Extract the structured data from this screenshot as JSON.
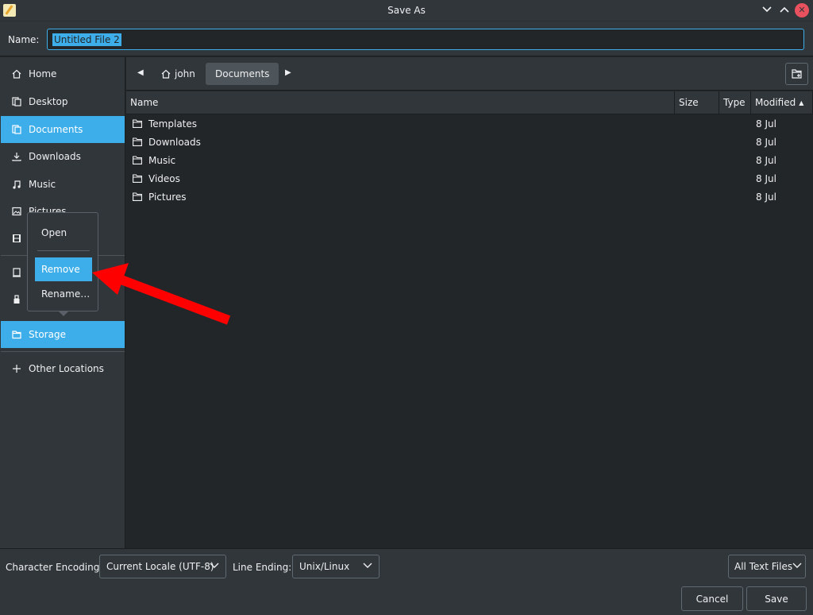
{
  "window": {
    "title": "Save As"
  },
  "name_row": {
    "label": "Name:",
    "value": "Untitled File 2"
  },
  "sidebar": {
    "items": [
      {
        "label": "Home",
        "icon": "home-icon"
      },
      {
        "label": "Desktop",
        "icon": "desktop-icon"
      },
      {
        "label": "Documents",
        "icon": "documents-icon",
        "active": true
      },
      {
        "label": "Downloads",
        "icon": "download-icon"
      },
      {
        "label": "Music",
        "icon": "music-icon"
      },
      {
        "label": "Pictures",
        "icon": "pictures-icon"
      },
      {
        "label": "",
        "icon": "videos-icon"
      },
      {
        "label": "",
        "icon": "device-icon"
      },
      {
        "label": "",
        "icon": "usb-icon"
      },
      {
        "label": "Storage",
        "icon": "folder-icon",
        "active": true
      },
      {
        "label": "Other Locations",
        "icon": "plus-icon"
      }
    ]
  },
  "path_bar": {
    "crumbs": [
      {
        "label": "john",
        "icon": "home-icon"
      },
      {
        "label": "Documents",
        "active": true
      }
    ]
  },
  "file_list": {
    "columns": {
      "name": "Name",
      "size": "Size",
      "type": "Type",
      "modified": "Modified"
    },
    "rows": [
      {
        "name": "Templates",
        "modified": "8 Jul"
      },
      {
        "name": "Downloads",
        "modified": "8 Jul"
      },
      {
        "name": "Music",
        "modified": "8 Jul"
      },
      {
        "name": "Videos",
        "modified": "8 Jul"
      },
      {
        "name": "Pictures",
        "modified": "8 Jul"
      }
    ]
  },
  "context_menu": {
    "open": "Open",
    "remove": "Remove",
    "rename": "Rename…"
  },
  "bottom": {
    "encoding_label": "Character Encoding:",
    "encoding_value": "Current Locale (UTF-8)",
    "line_ending_label": "Line Ending:",
    "line_ending_value": "Unix/Linux",
    "filter_value": "All Text Files",
    "cancel_label": "Cancel",
    "save_label": "Save"
  },
  "colors": {
    "accent": "#3daee9",
    "annotation_arrow": "#ff0000",
    "close": "#e9515f"
  }
}
